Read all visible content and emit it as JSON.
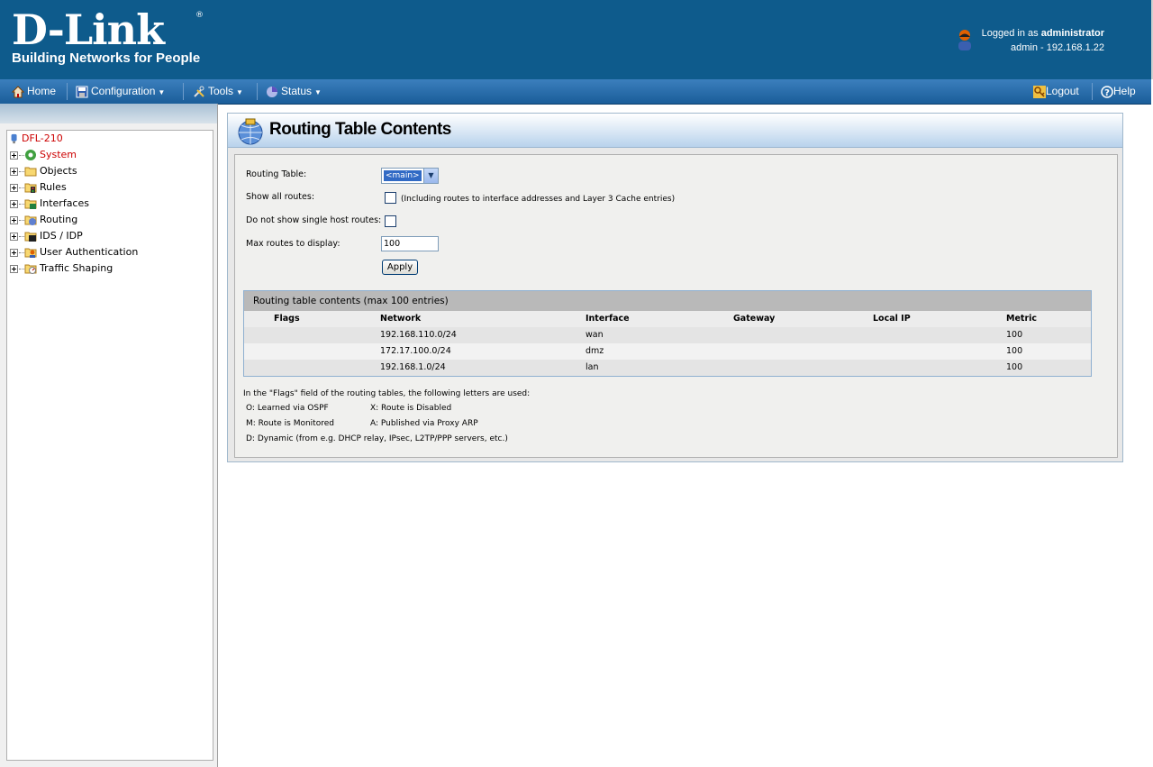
{
  "header": {
    "brand": "D-Link",
    "registered": "®",
    "tagline": "Building Networks for People",
    "logged_in_prefix": "Logged in as",
    "username": "administrator",
    "session": "admin - 192.168.1.22"
  },
  "menu": {
    "home": "Home",
    "configuration": "Configuration",
    "tools": "Tools",
    "status": "Status",
    "logout": "Logout",
    "help": "Help"
  },
  "tree": {
    "root": "DFL-210",
    "items": [
      {
        "label": "System",
        "icon": "gear-icon"
      },
      {
        "label": "Objects",
        "icon": "folder-icon"
      },
      {
        "label": "Rules",
        "icon": "rules-icon"
      },
      {
        "label": "Interfaces",
        "icon": "interfaces-icon"
      },
      {
        "label": "Routing",
        "icon": "routing-icon"
      },
      {
        "label": "IDS / IDP",
        "icon": "ids-icon"
      },
      {
        "label": "User Authentication",
        "icon": "user-auth-icon"
      },
      {
        "label": "Traffic Shaping",
        "icon": "traffic-shaping-icon"
      }
    ]
  },
  "page": {
    "title": "Routing Table Contents"
  },
  "form": {
    "routing_table_label": "Routing Table:",
    "routing_table_value": "<main>",
    "show_all_label": "Show all routes:",
    "show_all_note": "(Including routes to interface addresses and Layer 3 Cache entries)",
    "single_host_label": "Do not show single host routes:",
    "max_routes_label": "Max routes to display:",
    "max_routes_value": "100",
    "apply_label": "Apply"
  },
  "routes": {
    "caption": "Routing table contents (max 100 entries)",
    "columns": [
      "Flags",
      "Network",
      "Interface",
      "Gateway",
      "Local IP",
      "Metric"
    ],
    "rows": [
      {
        "flags": "",
        "network": "192.168.110.0/24",
        "interface": "wan",
        "gateway": "",
        "local_ip": "",
        "metric": "100"
      },
      {
        "flags": "",
        "network": "172.17.100.0/24",
        "interface": "dmz",
        "gateway": "",
        "local_ip": "",
        "metric": "100"
      },
      {
        "flags": "",
        "network": "192.168.1.0/24",
        "interface": "lan",
        "gateway": "",
        "local_ip": "",
        "metric": "100"
      }
    ]
  },
  "legend": {
    "intro": "In the \"Flags\" field of the routing tables, the following letters are used:",
    "o": "O: Learned via OSPF",
    "x": "X: Route is Disabled",
    "m": "M: Route is Monitored",
    "a": "A: Published via Proxy ARP",
    "d": "D: Dynamic (from e.g. DHCP relay, IPsec, L2TP/PPP servers, etc.)"
  },
  "colors": {
    "header_bg": "#0e5b8c",
    "menubar": "#1a5d99",
    "tree_red": "#cc0000"
  }
}
